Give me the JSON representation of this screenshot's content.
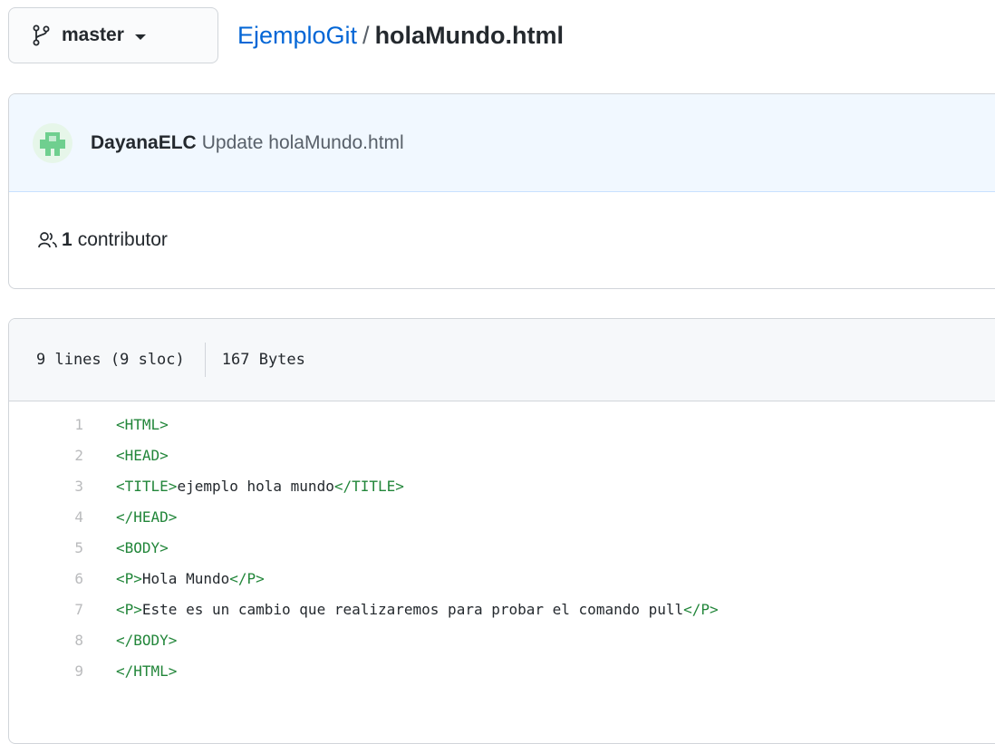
{
  "branch": {
    "label": "master"
  },
  "breadcrumb": {
    "repo": "EjemploGit",
    "separator": "/",
    "file": "holaMundo.html"
  },
  "commit": {
    "author": "DayanaELC",
    "message": "Update holaMundo.html"
  },
  "contributors": {
    "count": "1",
    "label": "contributor"
  },
  "file_info": {
    "lines": "9 lines (9 sloc)",
    "size": "167 Bytes"
  },
  "code_lines": [
    {
      "num": "1",
      "tokens": [
        {
          "t": "<HTML>",
          "tag": true
        }
      ]
    },
    {
      "num": "2",
      "tokens": [
        {
          "t": "<HEAD>",
          "tag": true
        }
      ]
    },
    {
      "num": "3",
      "tokens": [
        {
          "t": "<TITLE>",
          "tag": true
        },
        {
          "t": "ejemplo hola mundo",
          "tag": false
        },
        {
          "t": "</TITLE>",
          "tag": true
        }
      ]
    },
    {
      "num": "4",
      "tokens": [
        {
          "t": "</HEAD>",
          "tag": true
        }
      ]
    },
    {
      "num": "5",
      "tokens": [
        {
          "t": "<BODY>",
          "tag": true
        }
      ]
    },
    {
      "num": "6",
      "tokens": [
        {
          "t": "<P>",
          "tag": true
        },
        {
          "t": "Hola Mundo",
          "tag": false
        },
        {
          "t": "</P>",
          "tag": true
        }
      ]
    },
    {
      "num": "7",
      "tokens": [
        {
          "t": "<P>",
          "tag": true
        },
        {
          "t": "Este es un cambio que realizaremos para probar el comando pull",
          "tag": false
        },
        {
          "t": "</P>",
          "tag": true
        }
      ]
    },
    {
      "num": "8",
      "tokens": [
        {
          "t": "</BODY>",
          "tag": true
        }
      ]
    },
    {
      "num": "9",
      "tokens": [
        {
          "t": "</HTML>",
          "tag": true
        }
      ]
    }
  ],
  "colors": {
    "link": "#0366d6",
    "tag": "#22863a",
    "commit_bg": "#f1f8ff",
    "line_number": "#babbbd"
  },
  "icons": {
    "branch": "git-branch-icon",
    "caret": "caret-down-icon",
    "contributors": "people-icon",
    "avatar": "identicon-avatar"
  }
}
